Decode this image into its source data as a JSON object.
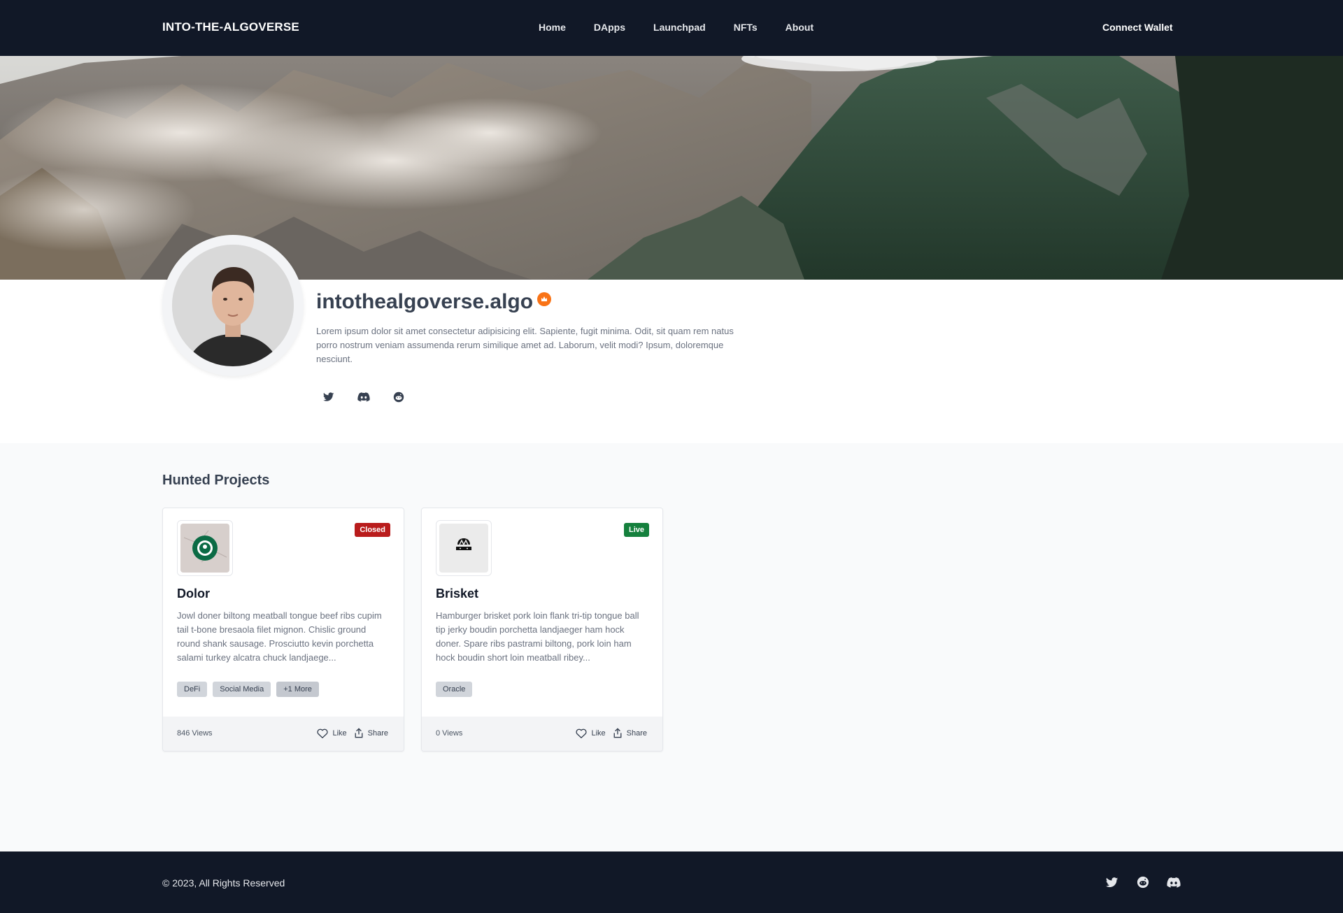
{
  "nav": {
    "brand": "INTO-THE-ALGOVERSE",
    "links": [
      "Home",
      "DApps",
      "Launchpad",
      "NFTs",
      "About"
    ],
    "connect_label": "Connect Wallet"
  },
  "profile": {
    "username": "intothealgoverse.algo",
    "bio": "Lorem ipsum dolor sit amet consectetur adipisicing elit. Sapiente, fugit minima. Odit, sit quam rem natus porro nostrum veniam assumenda rerum similique amet ad. Laborum, velit modi? Ipsum, doloremque nesciunt.",
    "socials": [
      "twitter-icon",
      "discord-icon",
      "reddit-icon"
    ]
  },
  "section": {
    "title": "Hunted Projects"
  },
  "projects": [
    {
      "title": "Dolor",
      "status": "Closed",
      "description": "Jowl doner biltong meatball tongue beef ribs cupim tail t-bone bresaola filet mignon. Chislic ground round shank sausage. Prosciutto kevin porchetta salami turkey alcatra chuck landjaege...",
      "tags": [
        "DeFi",
        "Social Media",
        "+1 More"
      ],
      "views": "846 Views",
      "like_label": "Like",
      "share_label": "Share"
    },
    {
      "title": "Brisket",
      "status": "Live",
      "description": "Hamburger brisket pork loin flank tri-tip tongue ball tip jerky boudin porchetta landjaeger ham hock doner. Spare ribs pastrami biltong, pork loin ham hock boudin short loin meatball ribey...",
      "tags": [
        "Oracle"
      ],
      "views": "0 Views",
      "like_label": "Like",
      "share_label": "Share"
    }
  ],
  "footer": {
    "copyright": "© 2023, All Rights Reserved",
    "socials": [
      "twitter-icon",
      "reddit-icon",
      "discord-icon"
    ]
  },
  "colors": {
    "nav_bg": "#111827",
    "verified": "#f97316",
    "closed": "#b91c1c",
    "live": "#15803d"
  }
}
